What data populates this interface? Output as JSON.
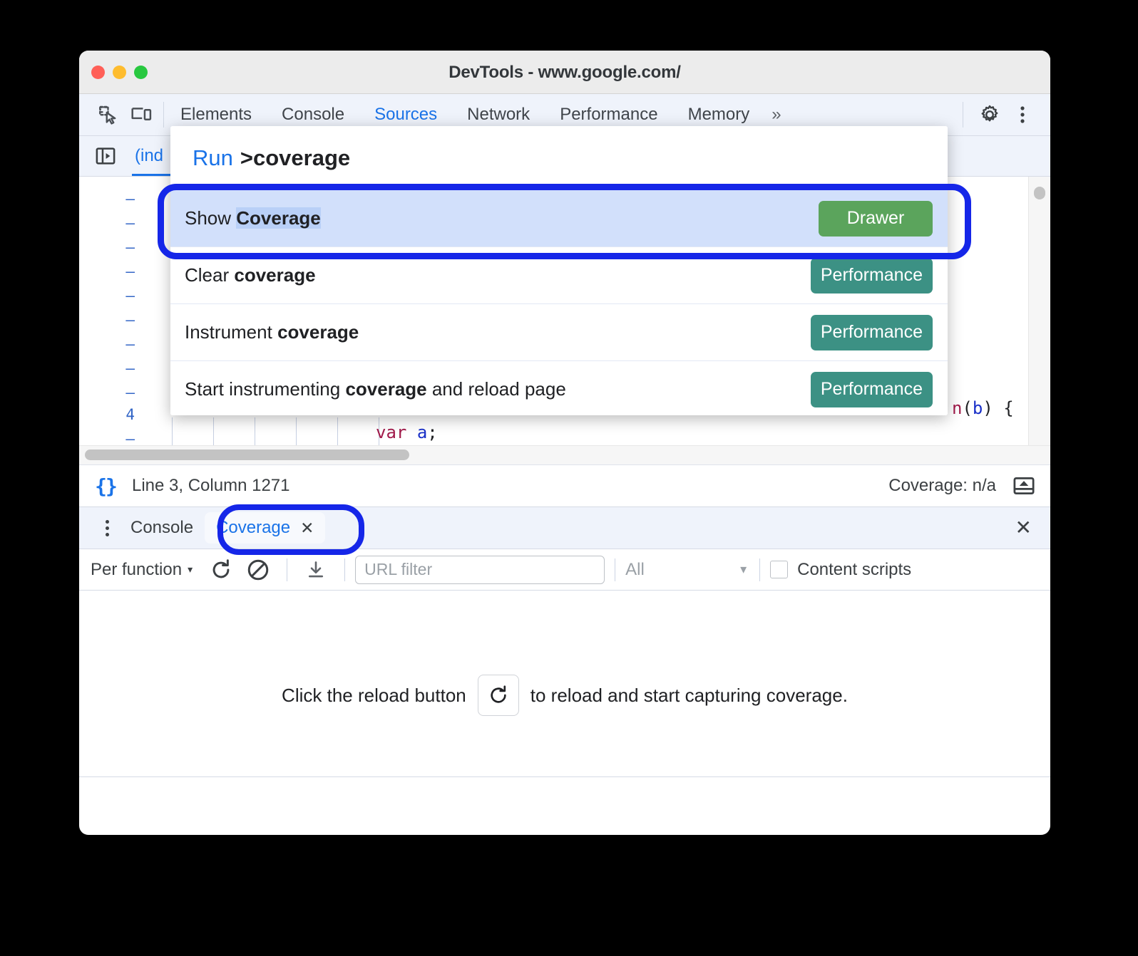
{
  "window": {
    "title": "DevTools - www.google.com/",
    "traffic_lights": [
      "close",
      "minimize",
      "zoom"
    ]
  },
  "devtools_toolbar": {
    "left_icons": [
      "inspect-element-icon",
      "device-toolbar-icon"
    ],
    "tabs": [
      {
        "label": "Elements",
        "active": false
      },
      {
        "label": "Console",
        "active": false
      },
      {
        "label": "Sources",
        "active": true
      },
      {
        "label": "Network",
        "active": false
      },
      {
        "label": "Performance",
        "active": false
      },
      {
        "label": "Memory",
        "active": false
      }
    ],
    "more_tabs": "»",
    "right_icons": [
      "settings-gear-icon",
      "more-options-icon"
    ]
  },
  "sources": {
    "navigator_toggle_icon": "show-navigator-icon",
    "file_tab_label": "(ind",
    "editor": {
      "gutter_lines": [
        "–",
        "–",
        "–",
        "–",
        "–",
        "–",
        "–",
        "–",
        "–",
        "4",
        "–"
      ],
      "visible_code": [
        "n(b) {",
        "var a;"
      ]
    }
  },
  "command_palette": {
    "prefix": "Run",
    "query": ">coverage",
    "rows": [
      {
        "text_before": "Show ",
        "highlight": "Coverage",
        "text_after": "",
        "badge": "Drawer",
        "badge_kind": "drawer",
        "selected": true
      },
      {
        "text_before": "Clear ",
        "highlight": "coverage",
        "text_after": "",
        "badge": "Performance",
        "badge_kind": "performance",
        "selected": false
      },
      {
        "text_before": "Instrument ",
        "highlight": "coverage",
        "text_after": "",
        "badge": "Performance",
        "badge_kind": "performance",
        "selected": false
      },
      {
        "text_before": "Start instrumenting ",
        "highlight": "coverage",
        "text_after": " and reload page",
        "badge": "Performance",
        "badge_kind": "performance",
        "selected": false
      }
    ]
  },
  "status_bar": {
    "format_icon": "pretty-print-braces-icon",
    "position": "Line 3, Column 1271",
    "coverage": "Coverage: n/a",
    "drawer_toggle_icon": "show-drawer-icon"
  },
  "drawer": {
    "menu_icon": "more-tools-kebab-icon",
    "tabs": [
      {
        "label": "Console",
        "active": false,
        "closable": false
      },
      {
        "label": "Coverage",
        "active": true,
        "closable": true,
        "close_glyph": "✕"
      }
    ],
    "close_glyph": "✕"
  },
  "coverage_toolbar": {
    "granularity": "Per function",
    "granularity_caret": "▾",
    "reload_icon": "reload-icon",
    "clear_icon": "clear-all-icon",
    "export_icon": "download-export-icon",
    "url_filter_placeholder": "URL filter",
    "url_filter_value": "",
    "type_filter_value": "All",
    "type_filter_caret": "▾",
    "content_scripts_label": "Content scripts",
    "content_scripts_checked": false
  },
  "coverage_body": {
    "message_before": "Click the reload button",
    "message_icon": "reload-icon",
    "message_after": "to reload and start capturing coverage."
  },
  "annotations": {
    "ring_1_target": "Show Coverage command row",
    "ring_2_target": "Coverage drawer tab",
    "ring_color": "#1526e8"
  },
  "colors": {
    "accent_blue": "#1a73e8",
    "badge_drawer_green": "#5ba45c",
    "badge_performance_teal": "#3c9184",
    "selected_row_blue": "#d2e0fb",
    "toolbar_bg": "#eff3fb",
    "annotation_blue": "#1526e8"
  }
}
